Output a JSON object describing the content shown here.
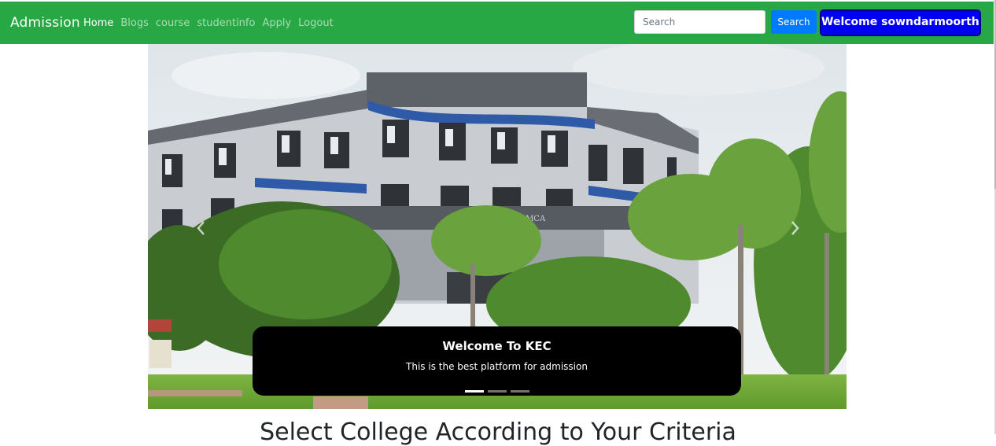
{
  "navbar": {
    "brand": "Admission",
    "links": [
      {
        "label": "Home",
        "active": true
      },
      {
        "label": "Blogs",
        "active": false
      },
      {
        "label": "course",
        "active": false
      },
      {
        "label": "studentinfo",
        "active": false
      },
      {
        "label": "Apply",
        "active": false
      },
      {
        "label": "Logout",
        "active": false
      }
    ],
    "search": {
      "placeholder": "Search",
      "value": "",
      "button_label": "Search"
    },
    "welcome_label": "Welcome sowndarmoorthy"
  },
  "carousel": {
    "building_sign": "MBA & MCA",
    "caption": {
      "title": "Welcome To KEC",
      "text": "This is the best platform for admission"
    },
    "slide_count": 3,
    "active_slide": 1
  },
  "main": {
    "heading": "Select College According to Your Criteria"
  },
  "colors": {
    "navbar_bg": "#28a745",
    "search_button": "#007bff",
    "welcome_button": "#0000f5"
  }
}
